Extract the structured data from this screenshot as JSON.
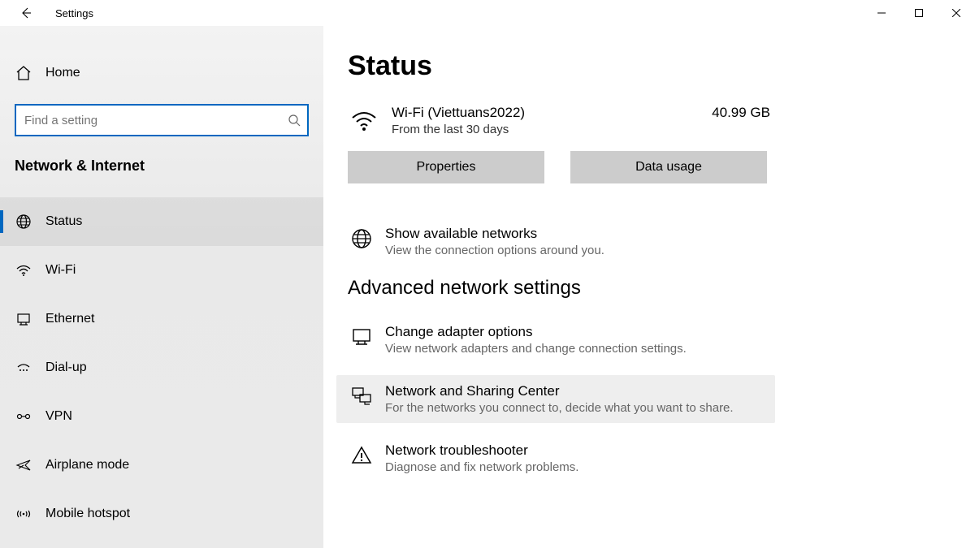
{
  "window": {
    "title": "Settings"
  },
  "sidebar": {
    "home_label": "Home",
    "search_placeholder": "Find a setting",
    "section_title": "Network & Internet",
    "items": [
      {
        "label": "Status"
      },
      {
        "label": "Wi-Fi"
      },
      {
        "label": "Ethernet"
      },
      {
        "label": "Dial-up"
      },
      {
        "label": "VPN"
      },
      {
        "label": "Airplane mode"
      },
      {
        "label": "Mobile hotspot"
      }
    ]
  },
  "status": {
    "heading": "Status",
    "network": {
      "name": "Wi-Fi (Viettuans2022)",
      "sub": "From the last 30 days",
      "usage": "40.99 GB"
    },
    "properties_btn": "Properties",
    "data_usage_btn": "Data usage",
    "available": {
      "title": "Show available networks",
      "desc": "View the connection options around you."
    },
    "advanced_heading": "Advanced network settings",
    "adapter": {
      "title": "Change adapter options",
      "desc": "View network adapters and change connection settings."
    },
    "sharing": {
      "title": "Network and Sharing Center",
      "desc": "For the networks you connect to, decide what you want to share."
    },
    "troubleshooter": {
      "title": "Network troubleshooter",
      "desc": "Diagnose and fix network problems."
    }
  }
}
